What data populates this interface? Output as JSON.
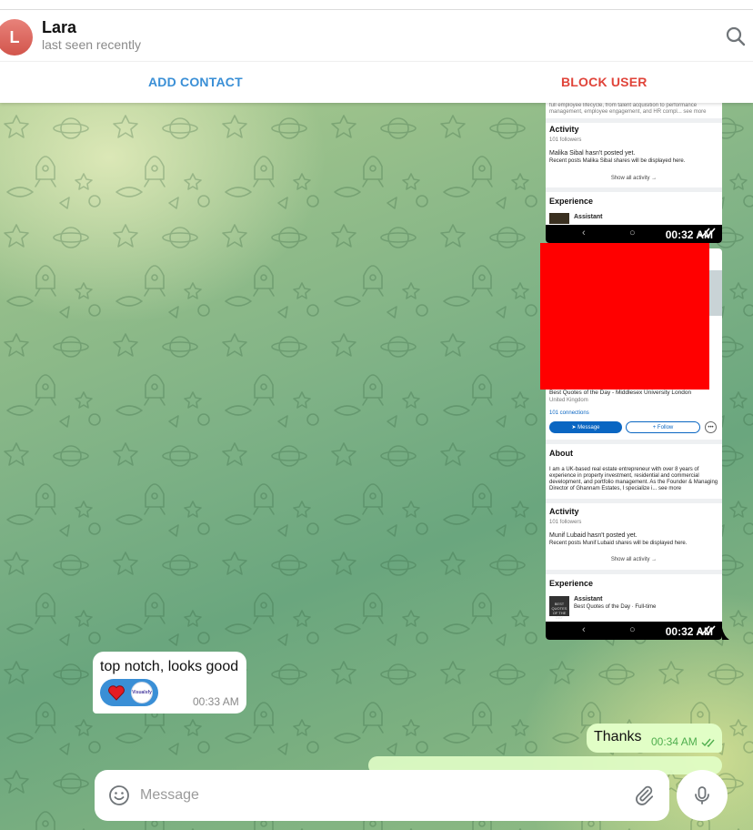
{
  "header": {
    "avatar_letter": "L",
    "title": "Lara",
    "status": "last seen recently",
    "search_icon": "search-icon"
  },
  "actions": {
    "add_contact": "ADD CONTACT",
    "block_user": "BLOCK USER"
  },
  "colors": {
    "accent": "#3a8fd6",
    "danger": "#e0443a",
    "outgoing_bubble": "#e1fec6",
    "read_check": "#4fae4e",
    "avatar": "#d2554c"
  },
  "messages": [
    {
      "type": "screenshot",
      "direction": "out",
      "time": "00:32 AM",
      "content": {
        "partial_about": "full employee lifecycle, from talent acquisition to performance management, employee engagement, and HR compl... see more",
        "activity_heading": "Activity",
        "followers": "101 followers",
        "no_posts": "Malika Sibal hasn't posted yet.",
        "recent_posts": "Recent posts Malika Sibal shares will be displayed here.",
        "show_all": "Show all activity →",
        "experience_heading": "Experience",
        "role": "Assistant"
      }
    },
    {
      "type": "screenshot",
      "direction": "out",
      "time": "00:32 AM",
      "content": {
        "headline": "Best Quotes of the Day - Middlesex University London",
        "location": "United Kingdom",
        "connections": "101 connections",
        "message_btn": "Message",
        "follow_btn": "+ Follow",
        "about_heading": "About",
        "about_text": "I am a UK-based real estate entrepreneur with over 8 years of experience in property investment, residential and commercial development, and portfolio management. As the Founder & Managing Director of Ghannam Estates, I specialize i... see more",
        "activity_heading": "Activity",
        "followers": "101 followers",
        "no_posts": "Munif Lubaid hasn't posted yet.",
        "recent_posts": "Recent posts Munif Lubaid shares will be displayed here.",
        "show_all": "Show all activity →",
        "experience_heading": "Experience",
        "role": "Assistant",
        "role_company": "Best Quotes of the Day · Full-time",
        "logo_text": "BEST QUOTES OF THE DAY"
      }
    },
    {
      "type": "text",
      "direction": "in",
      "text": "top notch, looks good",
      "time": "00:33 AM",
      "reaction": "heart-icon",
      "reaction_avatar_text": "Visualsfy"
    },
    {
      "type": "text",
      "direction": "out",
      "text": "Thanks",
      "time": "00:34 AM",
      "status": "read"
    }
  ],
  "composer": {
    "placeholder": "Message",
    "emoji_icon": "emoji-icon",
    "attach_icon": "paperclip-icon",
    "mic_icon": "microphone-icon"
  }
}
